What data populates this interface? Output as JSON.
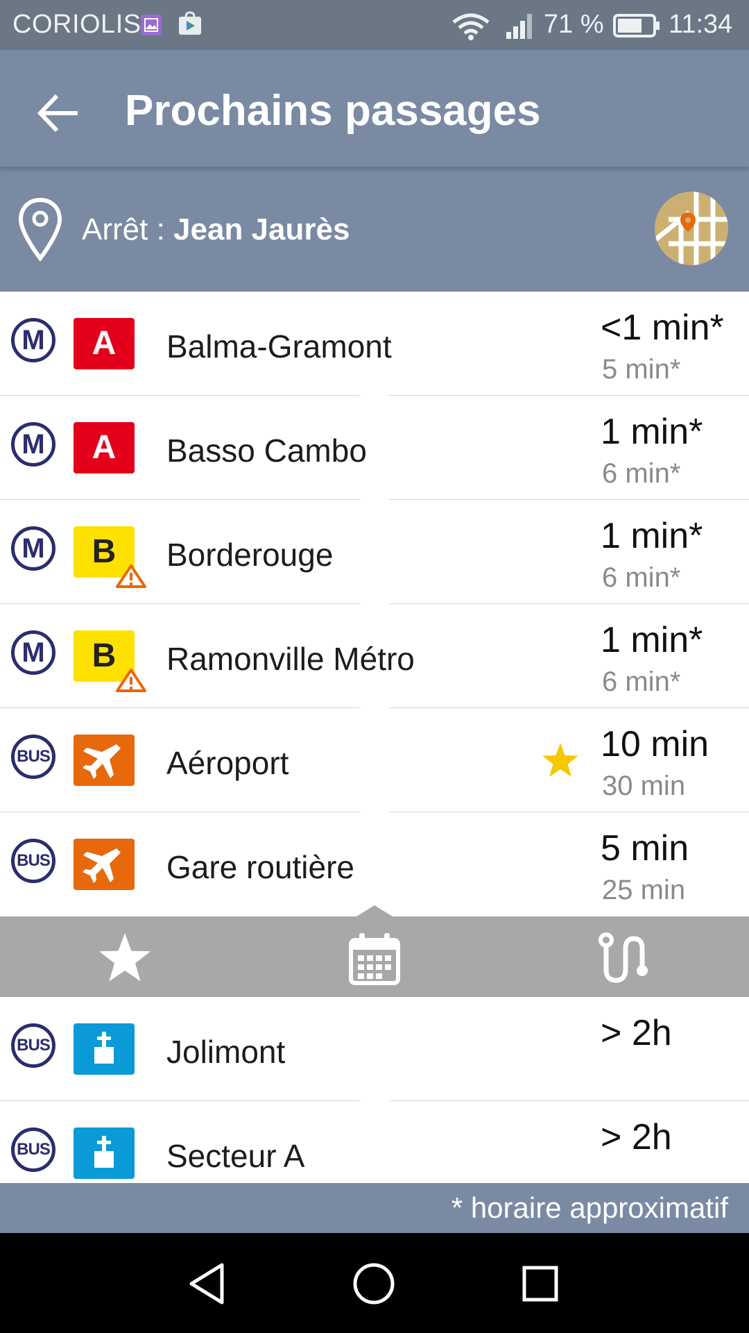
{
  "status_bar": {
    "carrier": "CORIOLIS",
    "battery": "71 %",
    "time": "11:34",
    "icons": [
      "gallery-icon",
      "play-store-icon",
      "wifi-icon",
      "signal-icon",
      "battery-icon"
    ]
  },
  "app_bar": {
    "title": "Prochains passages",
    "back_icon": "arrow-back-icon"
  },
  "stop": {
    "label": "Arrêt : ",
    "name": "Jean Jaurès",
    "map_icon": "map-marker-icon"
  },
  "colors": {
    "header": "#7a8aa3",
    "status_bar": "#6b7785",
    "metro_a": "#e3001b",
    "metro_b": "#ffe100",
    "airport_bus": "#e8680c",
    "cemetery_bus": "#0a9ad7",
    "mode_ring": "#2a2d6e",
    "favorite": "#f5c800",
    "toolbar": "#a8a8a8"
  },
  "departures": [
    {
      "mode": "M",
      "line": "A",
      "line_type": "metro-a",
      "destination": "Balma-Gramont",
      "next": "<1 min*",
      "following": "5 min*",
      "warning": false,
      "favorite": false
    },
    {
      "mode": "M",
      "line": "A",
      "line_type": "metro-a",
      "destination": "Basso Cambo",
      "next": "1 min*",
      "following": "6 min*",
      "warning": false,
      "favorite": false
    },
    {
      "mode": "M",
      "line": "B",
      "line_type": "metro-b",
      "destination": "Borderouge",
      "next": "1 min*",
      "following": "6 min*",
      "warning": true,
      "favorite": false
    },
    {
      "mode": "M",
      "line": "B",
      "line_type": "metro-b",
      "destination": "Ramonville Métro",
      "next": "1 min*",
      "following": "6 min*",
      "warning": true,
      "favorite": false
    },
    {
      "mode": "BUS",
      "line": "airplane-icon",
      "line_type": "airport",
      "destination": "Aéroport",
      "next": "10 min",
      "following": "30 min",
      "warning": false,
      "favorite": true
    },
    {
      "mode": "BUS",
      "line": "airplane-icon",
      "line_type": "airport",
      "destination": "Gare routière",
      "next": "5 min",
      "following": "25 min",
      "warning": false,
      "favorite": false
    },
    {
      "mode": "BUS",
      "line": "cemetery-icon",
      "line_type": "cemetery",
      "destination": "Jolimont",
      "next": "> 2h",
      "following": "",
      "warning": false,
      "favorite": false
    },
    {
      "mode": "BUS",
      "line": "cemetery-icon",
      "line_type": "cemetery",
      "destination": "Secteur A",
      "next": "> 2h",
      "following": "",
      "warning": false,
      "favorite": false
    }
  ],
  "toolbar": {
    "buttons": [
      "star-icon",
      "calendar-icon",
      "route-icon"
    ]
  },
  "footer": {
    "note": "* horaire approximatif"
  },
  "nav_bar": {
    "buttons": [
      "back-triangle-icon",
      "home-circle-icon",
      "recents-square-icon"
    ]
  }
}
